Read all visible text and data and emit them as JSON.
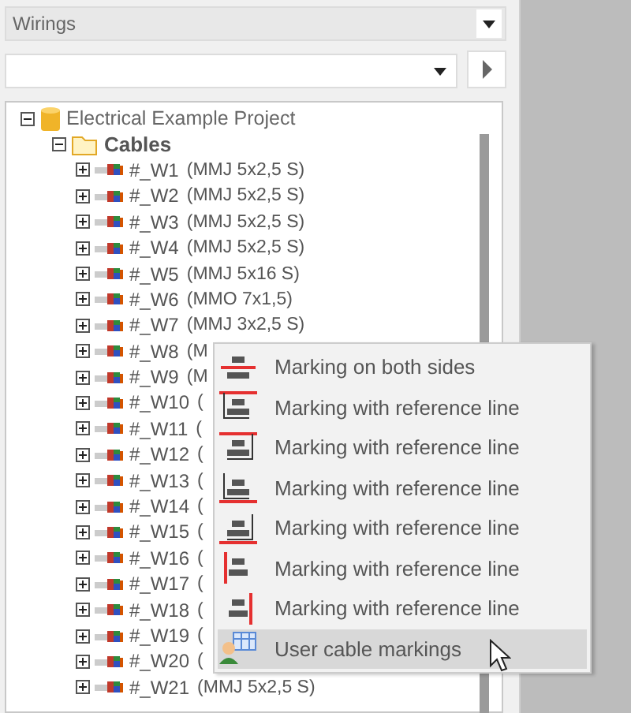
{
  "view_selector": {
    "value": "Wirings"
  },
  "tree": [
    {
      "label": "Electrical Example Project",
      "kind": "project",
      "expanded": true,
      "children": [
        {
          "label": "Cables",
          "kind": "folder",
          "expanded": true,
          "children": [
            {
              "label": "#_W1",
              "type": "(MMJ 5x2,5 S)",
              "expanded": false
            },
            {
              "label": "#_W2",
              "type": "(MMJ 5x2,5 S)",
              "expanded": false
            },
            {
              "label": "#_W3",
              "type": "(MMJ 5x2,5 S)",
              "expanded": false
            },
            {
              "label": "#_W4",
              "type": "(MMJ 5x2,5 S)",
              "expanded": false
            },
            {
              "label": "#_W5",
              "type": "(MMJ 5x16 S)",
              "expanded": false
            },
            {
              "label": "#_W6",
              "type": "(MMO 7x1,5)",
              "expanded": false
            },
            {
              "label": "#_W7",
              "type": "(MMJ 3x2,5 S)",
              "expanded": false
            },
            {
              "label": "#_W8",
              "type": "(M",
              "expanded": false
            },
            {
              "label": "#_W9",
              "type": "(M",
              "expanded": false
            },
            {
              "label": "#_W10",
              "type": "(",
              "expanded": false
            },
            {
              "label": "#_W11",
              "type": "(",
              "expanded": false
            },
            {
              "label": "#_W12",
              "type": "(",
              "expanded": false
            },
            {
              "label": "#_W13",
              "type": "(",
              "expanded": false
            },
            {
              "label": "#_W14",
              "type": "(",
              "expanded": false
            },
            {
              "label": "#_W15",
              "type": "(",
              "expanded": false
            },
            {
              "label": "#_W16",
              "type": "(",
              "expanded": false
            },
            {
              "label": "#_W17",
              "type": "(",
              "expanded": false
            },
            {
              "label": "#_W18",
              "type": "(",
              "expanded": false
            },
            {
              "label": "#_W19",
              "type": "(",
              "expanded": false
            },
            {
              "label": "#_W20",
              "type": "(",
              "expanded": false
            },
            {
              "label": "#_W21",
              "type": "(MMJ 5x2,5 S)",
              "expanded": false
            }
          ]
        }
      ]
    }
  ],
  "context_menu": [
    {
      "label": "Marking on both sides",
      "kind": "both",
      "selected": false
    },
    {
      "label": "Marking with reference line",
      "kind": "ref-top-left",
      "selected": false
    },
    {
      "label": "Marking with reference line",
      "kind": "ref-top-right",
      "selected": false
    },
    {
      "label": "Marking with reference line",
      "kind": "ref-bottom-left",
      "selected": false
    },
    {
      "label": "Marking with reference line",
      "kind": "ref-bottom-right",
      "selected": false
    },
    {
      "label": "Marking with reference line",
      "kind": "ref-left",
      "selected": false
    },
    {
      "label": "Marking with reference line",
      "kind": "ref-right",
      "selected": false
    },
    {
      "label": "User cable markings",
      "kind": "user",
      "selected": true
    }
  ]
}
